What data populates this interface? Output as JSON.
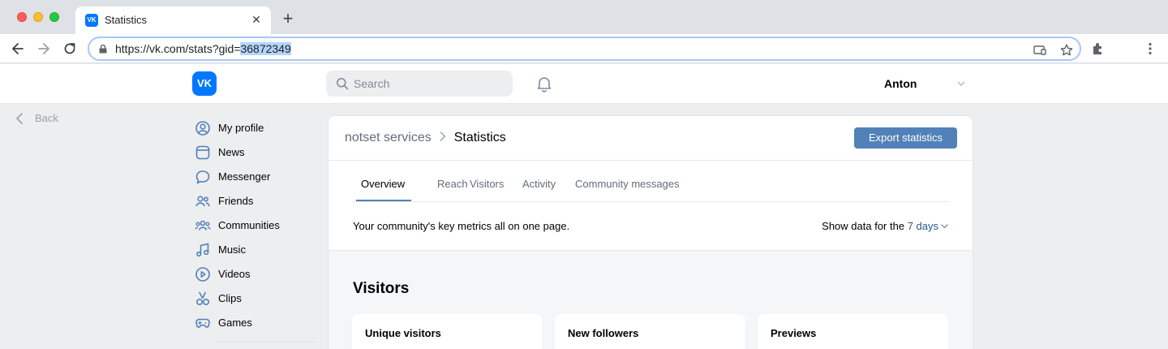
{
  "browser": {
    "tab_title": "Statistics",
    "favicon_text": "VK",
    "url_prefix": "https://vk.com/stats?gid=",
    "url_highlight": "36872349"
  },
  "header": {
    "logo_text": "VK",
    "search_placeholder": "Search",
    "user_name": "Anton"
  },
  "back_label": "Back",
  "sidebar": {
    "items": [
      {
        "label": "My profile",
        "icon": "user-icon"
      },
      {
        "label": "News",
        "icon": "news-icon"
      },
      {
        "label": "Messenger",
        "icon": "message-icon"
      },
      {
        "label": "Friends",
        "icon": "friends-icon"
      },
      {
        "label": "Communities",
        "icon": "communities-icon"
      },
      {
        "label": "Music",
        "icon": "music-icon"
      },
      {
        "label": "Videos",
        "icon": "video-icon"
      },
      {
        "label": "Clips",
        "icon": "clips-icon"
      },
      {
        "label": "Games",
        "icon": "games-icon"
      }
    ]
  },
  "main": {
    "breadcrumb_parent": "notset services",
    "breadcrumb_current": "Statistics",
    "export_label": "Export statistics",
    "tabs": [
      {
        "label": "Overview",
        "active": true
      },
      {
        "label": "Reach",
        "active": false
      },
      {
        "label": "Visitors",
        "active": false
      },
      {
        "label": "Activity",
        "active": false
      },
      {
        "label": "Community messages",
        "active": false
      }
    ],
    "key_metrics_text": "Your community's key metrics all on one page.",
    "show_data_label": "Show data for the",
    "period": "7 days",
    "section_title": "Visitors",
    "cards": [
      {
        "title": "Unique visitors"
      },
      {
        "title": "New followers"
      },
      {
        "title": "Previews"
      }
    ]
  },
  "colors": {
    "accent": "#5181b8",
    "link": "#2a5885",
    "vk_blue": "#0077ff",
    "page_bg": "#edeef0"
  }
}
